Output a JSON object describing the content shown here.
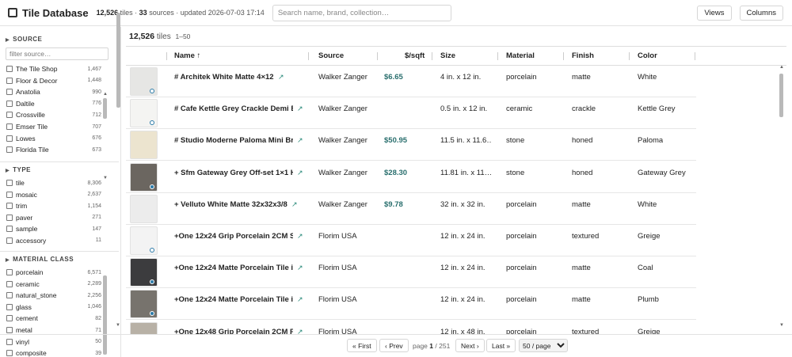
{
  "header": {
    "title": "Tile Database",
    "tiles_count": "12,526",
    "tiles_label": "tiles ·",
    "sources_count": "33",
    "sources_label": "sources · updated 2026-07-03 17:14",
    "search_placeholder": "Search name, brand, collection…",
    "views_label": "Views",
    "columns_label": "Columns"
  },
  "sidebar": {
    "source": {
      "heading": "SOURCE",
      "filter_placeholder": "filter source…",
      "items": [
        {
          "label": "The Tile Shop",
          "count": "1,467"
        },
        {
          "label": "Floor & Decor",
          "count": "1,448"
        },
        {
          "label": "Anatolia",
          "count": "990"
        },
        {
          "label": "Daltile",
          "count": "776"
        },
        {
          "label": "Crossville",
          "count": "712"
        },
        {
          "label": "Emser Tile",
          "count": "707"
        },
        {
          "label": "Lowes",
          "count": "676"
        },
        {
          "label": "Florida Tile",
          "count": "673"
        }
      ]
    },
    "type": {
      "heading": "TYPE",
      "items": [
        {
          "label": "tile",
          "count": "8,306"
        },
        {
          "label": "mosaic",
          "count": "2,637"
        },
        {
          "label": "trim",
          "count": "1,154"
        },
        {
          "label": "paver",
          "count": "271"
        },
        {
          "label": "sample",
          "count": "147"
        },
        {
          "label": "accessory",
          "count": "11"
        }
      ]
    },
    "material_class": {
      "heading": "MATERIAL CLASS",
      "items": [
        {
          "label": "porcelain",
          "count": "6,571"
        },
        {
          "label": "ceramic",
          "count": "2,289"
        },
        {
          "label": "natural_stone",
          "count": "2,256"
        },
        {
          "label": "glass",
          "count": "1,046"
        },
        {
          "label": "cement",
          "count": "82"
        },
        {
          "label": "metal",
          "count": "71"
        },
        {
          "label": "vinyl",
          "count": "50"
        },
        {
          "label": "composite",
          "count": "39"
        }
      ]
    }
  },
  "results": {
    "count": "12,526",
    "unit": "tiles",
    "range": "1–50"
  },
  "table": {
    "columns": {
      "name": "Name",
      "sort_indicator": "↑",
      "source": "Source",
      "price": "$/sqft",
      "size": "Size",
      "material": "Material",
      "finish": "Finish",
      "color": "Color"
    },
    "link_icon": "↗",
    "rows": [
      {
        "name": "# Architek White Matte 4×12",
        "source": "Walker Zanger",
        "price": "$6.65",
        "size": "4 in. x 12 in.",
        "material": "porcelain",
        "finish": "matte",
        "color": "White",
        "swatch": "#e6e6e4",
        "dot": "ring"
      },
      {
        "name": "# Cafe Kettle Grey Crackle Demi Bn …",
        "source": "Walker Zanger",
        "price": "",
        "size": "0.5 in. x 12 in.",
        "material": "ceramic",
        "finish": "crackle",
        "color": "Kettle Grey",
        "swatch": "#f4f4f2",
        "dot": "ring"
      },
      {
        "name": "# Studio Moderne Paloma Mini Brick…",
        "source": "Walker Zanger",
        "price": "$50.95",
        "size": "11.5 in. x 11.6…",
        "material": "stone",
        "finish": "honed",
        "color": "Paloma",
        "swatch": "#ece4cf",
        "dot": "none"
      },
      {
        "name": "+ Sfm Gateway Grey Off-set 1×1 Hon…",
        "source": "Walker Zanger",
        "price": "$28.30",
        "size": "11.81 in. x 11…",
        "material": "stone",
        "finish": "honed",
        "color": "Gateway Grey",
        "swatch": "#6b6660",
        "dot": "filled"
      },
      {
        "name": "+ Velluto White Matte 32x32x3/8",
        "source": "Walker Zanger",
        "price": "$9.78",
        "size": "32 in. x 32 in.",
        "material": "porcelain",
        "finish": "matte",
        "color": "White",
        "swatch": "#ececec",
        "dot": "none"
      },
      {
        "name": "+One 12x24 Grip Porcelain 2CM Stai…",
        "source": "Florim USA",
        "price": "",
        "size": "12 in. x 24 in.",
        "material": "porcelain",
        "finish": "textured",
        "color": "Greige",
        "swatch": "#f3f3f3",
        "dot": "ring"
      },
      {
        "name": "+One 12x24 Matte Porcelain Tile in …",
        "source": "Florim USA",
        "price": "",
        "size": "12 in. x 24 in.",
        "material": "porcelain",
        "finish": "matte",
        "color": "Coal",
        "swatch": "#3c3c3e",
        "dot": "filled"
      },
      {
        "name": "+One 12x24 Matte Porcelain Tile in …",
        "source": "Florim USA",
        "price": "",
        "size": "12 in. x 24 in.",
        "material": "porcelain",
        "finish": "matte",
        "color": "Plumb",
        "swatch": "#77736d",
        "dot": "filled"
      },
      {
        "name": "+One 12x48 Grip Porcelain 2CM Pav…",
        "source": "Florim USA",
        "price": "",
        "size": "12 in. x 48 in.",
        "material": "porcelain",
        "finish": "textured",
        "color": "Greige",
        "swatch": "#b8b1a6",
        "dot": "none"
      }
    ]
  },
  "pager": {
    "first": "« First",
    "prev": "‹ Prev",
    "page_label": "page",
    "page": "1",
    "sep": "/",
    "total_pages": "251",
    "next": "Next ›",
    "last": "Last »",
    "per_page": "50 / page"
  },
  "colors": {
    "price": "#2a6f6e",
    "link": "#2a8a7a",
    "dot": "#2a7aa8"
  }
}
